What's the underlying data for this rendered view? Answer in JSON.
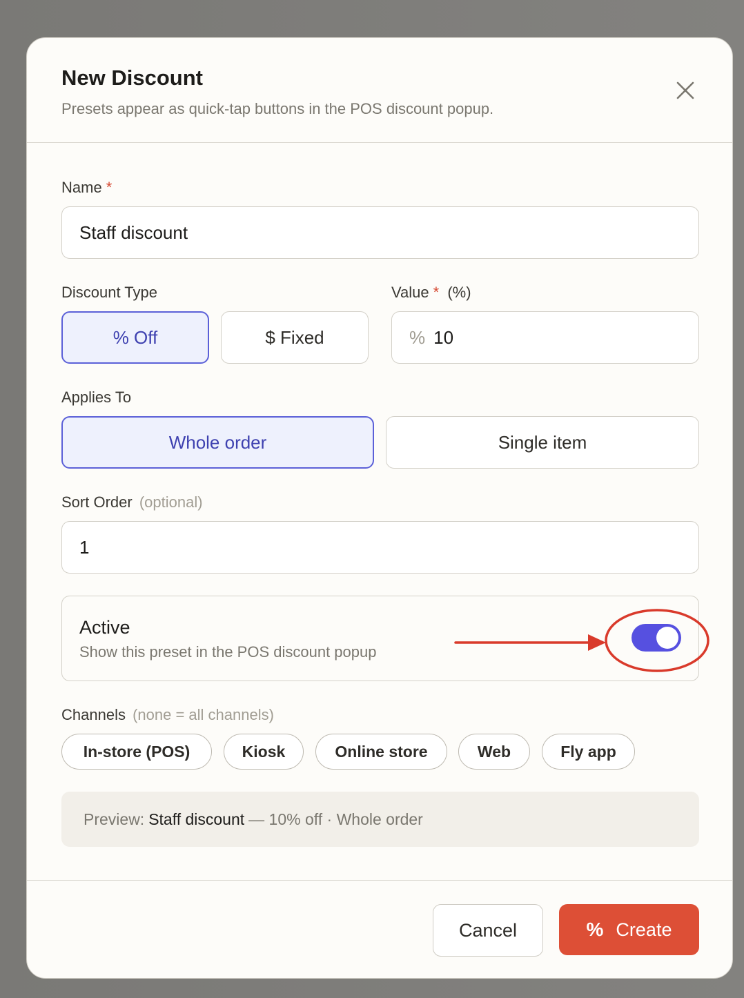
{
  "modal": {
    "title": "New Discount",
    "subtitle": "Presets appear as quick-tap buttons in the POS discount popup."
  },
  "form": {
    "name": {
      "label": "Name",
      "required_mark": "*",
      "value": "Staff discount"
    },
    "discount_type": {
      "label": "Discount Type",
      "options": [
        "% Off",
        "$ Fixed"
      ],
      "selected": "% Off"
    },
    "value": {
      "label": "Value",
      "required_mark": "*",
      "unit_hint": "(%)",
      "prefix": "%",
      "value": "10"
    },
    "applies_to": {
      "label": "Applies To",
      "options": [
        "Whole order",
        "Single item"
      ],
      "selected": "Whole order"
    },
    "sort_order": {
      "label": "Sort Order",
      "hint": "(optional)",
      "value": "1"
    },
    "active": {
      "title": "Active",
      "description": "Show this preset in the POS discount popup",
      "enabled": true
    },
    "channels": {
      "label": "Channels",
      "hint": "(none = all channels)",
      "items": [
        "In-store (POS)",
        "Kiosk",
        "Online store",
        "Web",
        "Fly app"
      ]
    },
    "preview": {
      "prefix": "Preview:",
      "name": "Staff discount",
      "summary": "— 10% off · Whole order"
    }
  },
  "footer": {
    "cancel_label": "Cancel",
    "create_icon": "%",
    "create_label": "Create"
  },
  "colors": {
    "accent": "#5650e0",
    "primary_button": "#dd4f36",
    "annotation": "#d93a2b"
  },
  "icons": {
    "close": "close-icon",
    "create": "percent-icon"
  }
}
